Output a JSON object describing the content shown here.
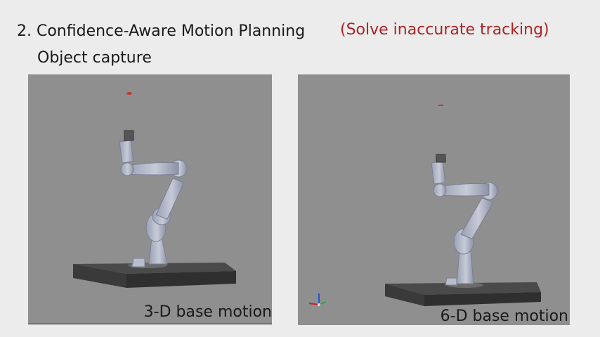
{
  "slide": {
    "title": "2. Confidence-Aware Motion Planning",
    "title_note": "(Solve inaccurate tracking)",
    "subtitle": "Object capture",
    "accent_color": "#b22222"
  },
  "panels": [
    {
      "caption": "3-D base motion",
      "target_marker_color": "#c0392b"
    },
    {
      "caption": "6-D base motion",
      "target_marker_color": "#c0392b",
      "axes_icon": "xyz-axes-icon"
    }
  ]
}
